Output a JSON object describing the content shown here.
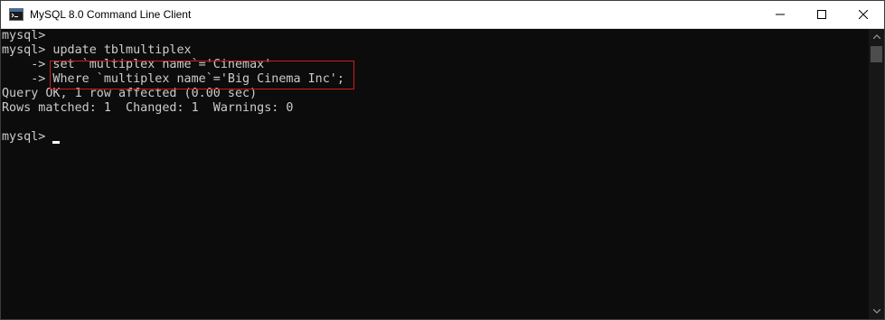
{
  "window": {
    "title": "MySQL 8.0 Command Line Client",
    "icon": "console-app-icon"
  },
  "controls": {
    "minimize": "minimize-icon",
    "maximize": "maximize-icon",
    "close": "close-icon"
  },
  "console": {
    "lines": [
      "mysql>",
      "mysql> update tblmultiplex",
      "    -> set `multiplex name`='Cinemax'",
      "    -> Where `multiplex name`='Big Cinema Inc';",
      "Query OK, 1 row affected (0.00 sec)",
      "Rows matched: 1  Changed: 1  Warnings: 0",
      "",
      "mysql> "
    ]
  },
  "colors": {
    "background": "#0c0c0c",
    "text": "#cccccc",
    "highlight": "#d21c1c"
  }
}
